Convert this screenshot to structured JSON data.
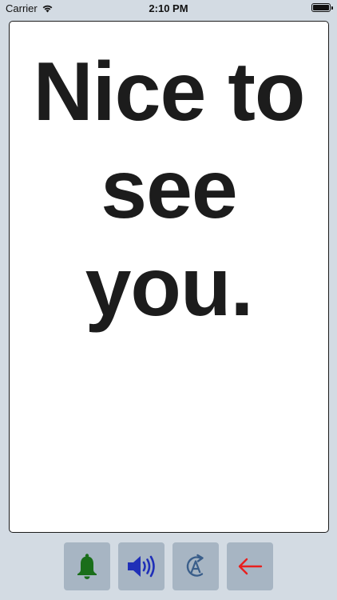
{
  "status_bar": {
    "carrier": "Carrier",
    "time": "2:10 PM",
    "icons": [
      "wifi-icon",
      "battery-icon"
    ]
  },
  "card": {
    "message": "Nice to see you."
  },
  "toolbar": {
    "buttons": [
      {
        "name": "bell-button",
        "icon": "bell-icon",
        "color": "#1a6e1a"
      },
      {
        "name": "speaker-button",
        "icon": "speaker-icon",
        "color": "#1f2fb8"
      },
      {
        "name": "font-rotate-button",
        "icon": "text-rotate-icon",
        "color": "#3a5e8a"
      },
      {
        "name": "back-button",
        "icon": "arrow-left-icon",
        "color": "#e8201e"
      }
    ]
  },
  "colors": {
    "background": "#d3dbe3",
    "button_background": "#a7b5c3",
    "text": "#1c1c1c"
  }
}
